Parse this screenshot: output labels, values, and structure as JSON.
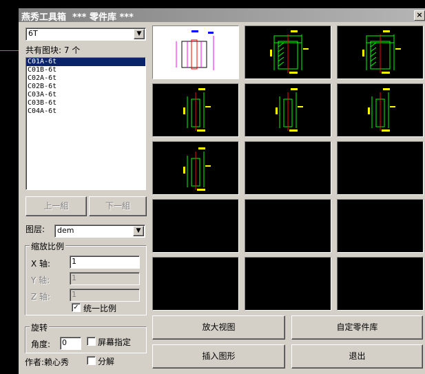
{
  "dialog": {
    "title": "燕秀工具箱  *** 零件库 ***",
    "close_label": "×"
  },
  "series_select": {
    "value": "6T"
  },
  "block_count_label": "共有图块: 7 个",
  "blocks": {
    "items": [
      "C01A-6t",
      "C01B-6t",
      "C02A-6t",
      "C02B-6t",
      "C03A-6t",
      "C03B-6t",
      "C04A-6t"
    ],
    "selected": "C01A-6t"
  },
  "pager": {
    "prev_label": "上一組",
    "next_label": "下一組"
  },
  "layer": {
    "label": "图层:",
    "value": "dem"
  },
  "scale": {
    "group_title": "缩放比例",
    "x_label": "X 轴:",
    "x_value": "1",
    "y_label": "Y 轴:",
    "y_value": "1",
    "z_label": "Z 轴:",
    "z_value": "1",
    "uniform_label": "统一比例",
    "uniform_checked": true
  },
  "rotate": {
    "group_title": "旋转",
    "angle_label": "角度:",
    "angle_value": "0",
    "screen_label": "屏幕指定",
    "screen_checked": false
  },
  "author_label": "作者:赖心秀",
  "explode": {
    "label": "分解",
    "checked": false
  },
  "actions": {
    "zoom_view": "放大视图",
    "custom_library": "自定零件库",
    "insert_shape": "插入图形",
    "exit": "退出"
  },
  "colors": {
    "cad_yellow": "#ffff00",
    "cad_green": "#00ff00",
    "cad_red": "#ff0000",
    "cad_blue": "#0000ff",
    "cad_magenta": "#ff00ff",
    "selection": "#0a246a"
  }
}
